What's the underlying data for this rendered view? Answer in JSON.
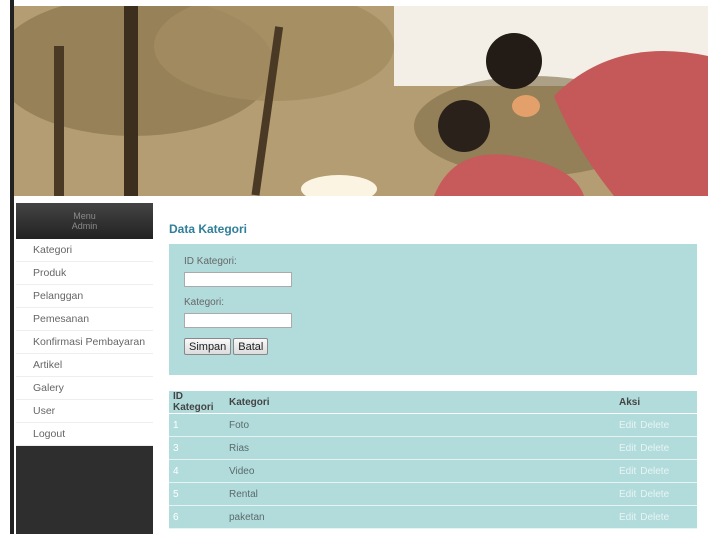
{
  "sidebar": {
    "header_line1": "Menu",
    "header_line2": "Admin",
    "items": [
      {
        "label": "Kategori"
      },
      {
        "label": "Produk"
      },
      {
        "label": "Pelanggan"
      },
      {
        "label": "Pemesanan"
      },
      {
        "label": "Konfirmasi Pembayaran"
      },
      {
        "label": "Artikel"
      },
      {
        "label": "Galery"
      },
      {
        "label": "User"
      },
      {
        "label": "Logout"
      }
    ]
  },
  "main": {
    "title": "Data Kategori",
    "form": {
      "id_label": "ID Kategori:",
      "id_value": "",
      "kategori_label": "Kategori:",
      "kategori_value": "",
      "save_label": "Simpan",
      "cancel_label": "Batal"
    },
    "table": {
      "headers": [
        "ID Kategori",
        "Kategori",
        "Aksi"
      ],
      "edit_label": "Edit",
      "delete_label": "Delete",
      "rows": [
        {
          "id": "1",
          "kategori": "Foto"
        },
        {
          "id": "3",
          "kategori": "Rias"
        },
        {
          "id": "4",
          "kategori": "Video"
        },
        {
          "id": "5",
          "kategori": "Rental"
        },
        {
          "id": "6",
          "kategori": "paketan"
        }
      ]
    }
  }
}
